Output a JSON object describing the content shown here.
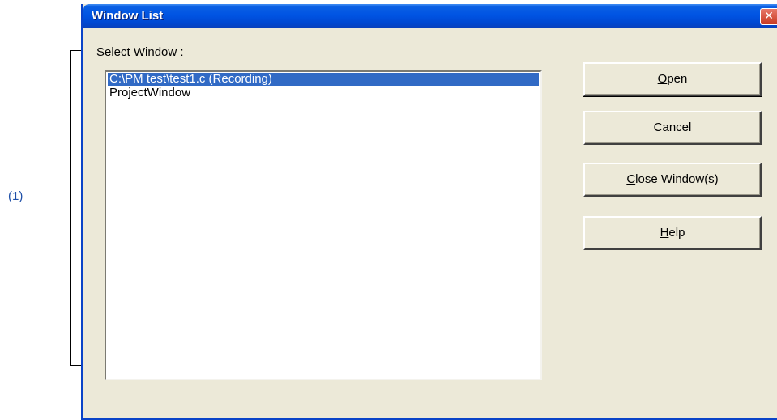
{
  "annotation": {
    "label": "(1)"
  },
  "dialog": {
    "title": "Window List",
    "close_icon": "close-icon",
    "select_label": {
      "underline": "W",
      "before": "Select ",
      "after": "indow :"
    },
    "list": {
      "items": [
        "C:\\PM test\\test1.c (Recording)",
        "ProjectWindow"
      ],
      "selected_index": 0
    },
    "buttons": {
      "open": {
        "mn": "O",
        "rest": "pen"
      },
      "cancel": {
        "label": "Cancel"
      },
      "close_windows": {
        "mn": "C",
        "rest": "lose Window(s)"
      },
      "help": {
        "mn": "H",
        "rest": "elp"
      }
    }
  },
  "colors": {
    "titlebar": "#0054e3",
    "selection": "#316ac5",
    "annotation": "#1e4fa8",
    "dialog_bg": "#ece9d8"
  }
}
